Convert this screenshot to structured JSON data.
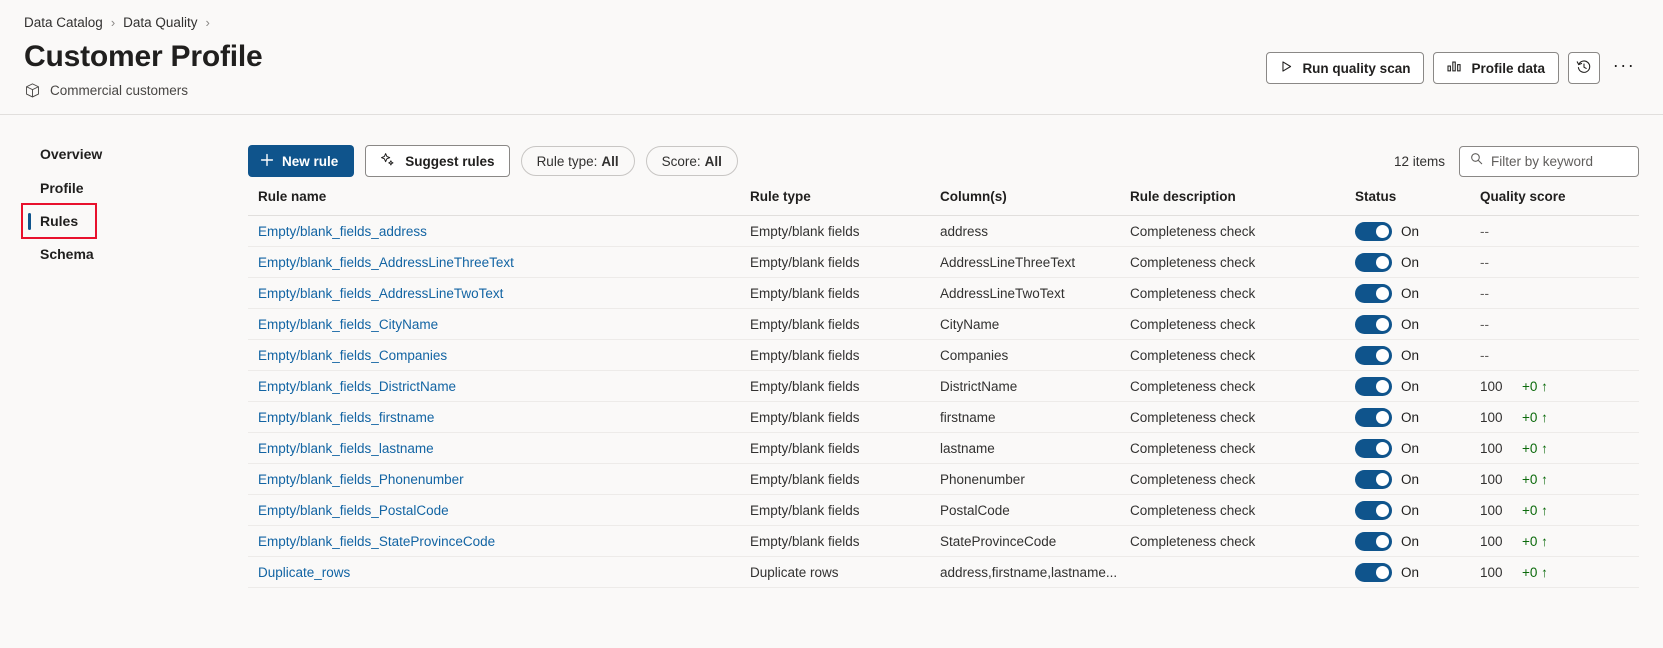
{
  "breadcrumb": {
    "items": [
      {
        "label": "Data Catalog"
      },
      {
        "label": "Data Quality"
      }
    ],
    "separator": "›"
  },
  "header": {
    "title": "Customer Profile",
    "subtitle": "Commercial customers",
    "subtitle_icon": "cube-icon",
    "actions": {
      "run_quality_scan": "Run quality scan",
      "run_quality_scan_icon": "play-triangle-icon",
      "profile_data": "Profile data",
      "profile_data_icon": "bar-chart-icon",
      "history_icon": "history-clock-icon",
      "more_label": "···"
    }
  },
  "sidebar": {
    "items": [
      {
        "label": "Overview",
        "selected": false
      },
      {
        "label": "Profile",
        "selected": false
      },
      {
        "label": "Rules",
        "selected": true
      },
      {
        "label": "Schema",
        "selected": false
      }
    ]
  },
  "toolbar": {
    "new_rule": "New rule",
    "new_rule_icon": "plus-icon",
    "suggest_rules": "Suggest rules",
    "suggest_rules_icon": "sparkle-icon",
    "filter_rule_type_label": "Rule type:",
    "filter_rule_type_value": "All",
    "filter_score_label": "Score:",
    "filter_score_value": "All",
    "item_count": "12 items",
    "search_placeholder": "Filter by keyword",
    "search_value": "",
    "search_icon": "search-icon"
  },
  "table": {
    "columns": [
      "Rule name",
      "Rule type",
      "Column(s)",
      "Rule description",
      "Status",
      "Quality score"
    ],
    "rows": [
      {
        "name": "Empty/blank_fields_address",
        "type": "Empty/blank fields",
        "columns": "address",
        "description": "Completeness check",
        "status": "On",
        "score": "--",
        "delta": ""
      },
      {
        "name": "Empty/blank_fields_AddressLineThreeText",
        "type": "Empty/blank fields",
        "columns": "AddressLineThreeText",
        "description": "Completeness check",
        "status": "On",
        "score": "--",
        "delta": ""
      },
      {
        "name": "Empty/blank_fields_AddressLineTwoText",
        "type": "Empty/blank fields",
        "columns": "AddressLineTwoText",
        "description": "Completeness check",
        "status": "On",
        "score": "--",
        "delta": ""
      },
      {
        "name": "Empty/blank_fields_CityName",
        "type": "Empty/blank fields",
        "columns": "CityName",
        "description": "Completeness check",
        "status": "On",
        "score": "--",
        "delta": ""
      },
      {
        "name": "Empty/blank_fields_Companies",
        "type": "Empty/blank fields",
        "columns": "Companies",
        "description": "Completeness check",
        "status": "On",
        "score": "--",
        "delta": ""
      },
      {
        "name": "Empty/blank_fields_DistrictName",
        "type": "Empty/blank fields",
        "columns": "DistrictName",
        "description": "Completeness check",
        "status": "On",
        "score": "100",
        "delta": "+0 ↑"
      },
      {
        "name": "Empty/blank_fields_firstname",
        "type": "Empty/blank fields",
        "columns": "firstname",
        "description": "Completeness check",
        "status": "On",
        "score": "100",
        "delta": "+0 ↑"
      },
      {
        "name": "Empty/blank_fields_lastname",
        "type": "Empty/blank fields",
        "columns": "lastname",
        "description": "Completeness check",
        "status": "On",
        "score": "100",
        "delta": "+0 ↑"
      },
      {
        "name": "Empty/blank_fields_Phonenumber",
        "type": "Empty/blank fields",
        "columns": "Phonenumber",
        "description": "Completeness check",
        "status": "On",
        "score": "100",
        "delta": "+0 ↑"
      },
      {
        "name": "Empty/blank_fields_PostalCode",
        "type": "Empty/blank fields",
        "columns": "PostalCode",
        "description": "Completeness check",
        "status": "On",
        "score": "100",
        "delta": "+0 ↑"
      },
      {
        "name": "Empty/blank_fields_StateProvinceCode",
        "type": "Empty/blank fields",
        "columns": "StateProvinceCode",
        "description": "Completeness check",
        "status": "On",
        "score": "100",
        "delta": "+0 ↑"
      },
      {
        "name": "Duplicate_rows",
        "type": "Duplicate rows",
        "columns": "address,firstname,lastname...",
        "description": "",
        "status": "On",
        "score": "100",
        "delta": "+0 ↑"
      }
    ]
  },
  "colors": {
    "accent": "#0f548c",
    "link": "#1264a3",
    "annotation": "#e8112d",
    "positive": "#0b6a0b"
  }
}
